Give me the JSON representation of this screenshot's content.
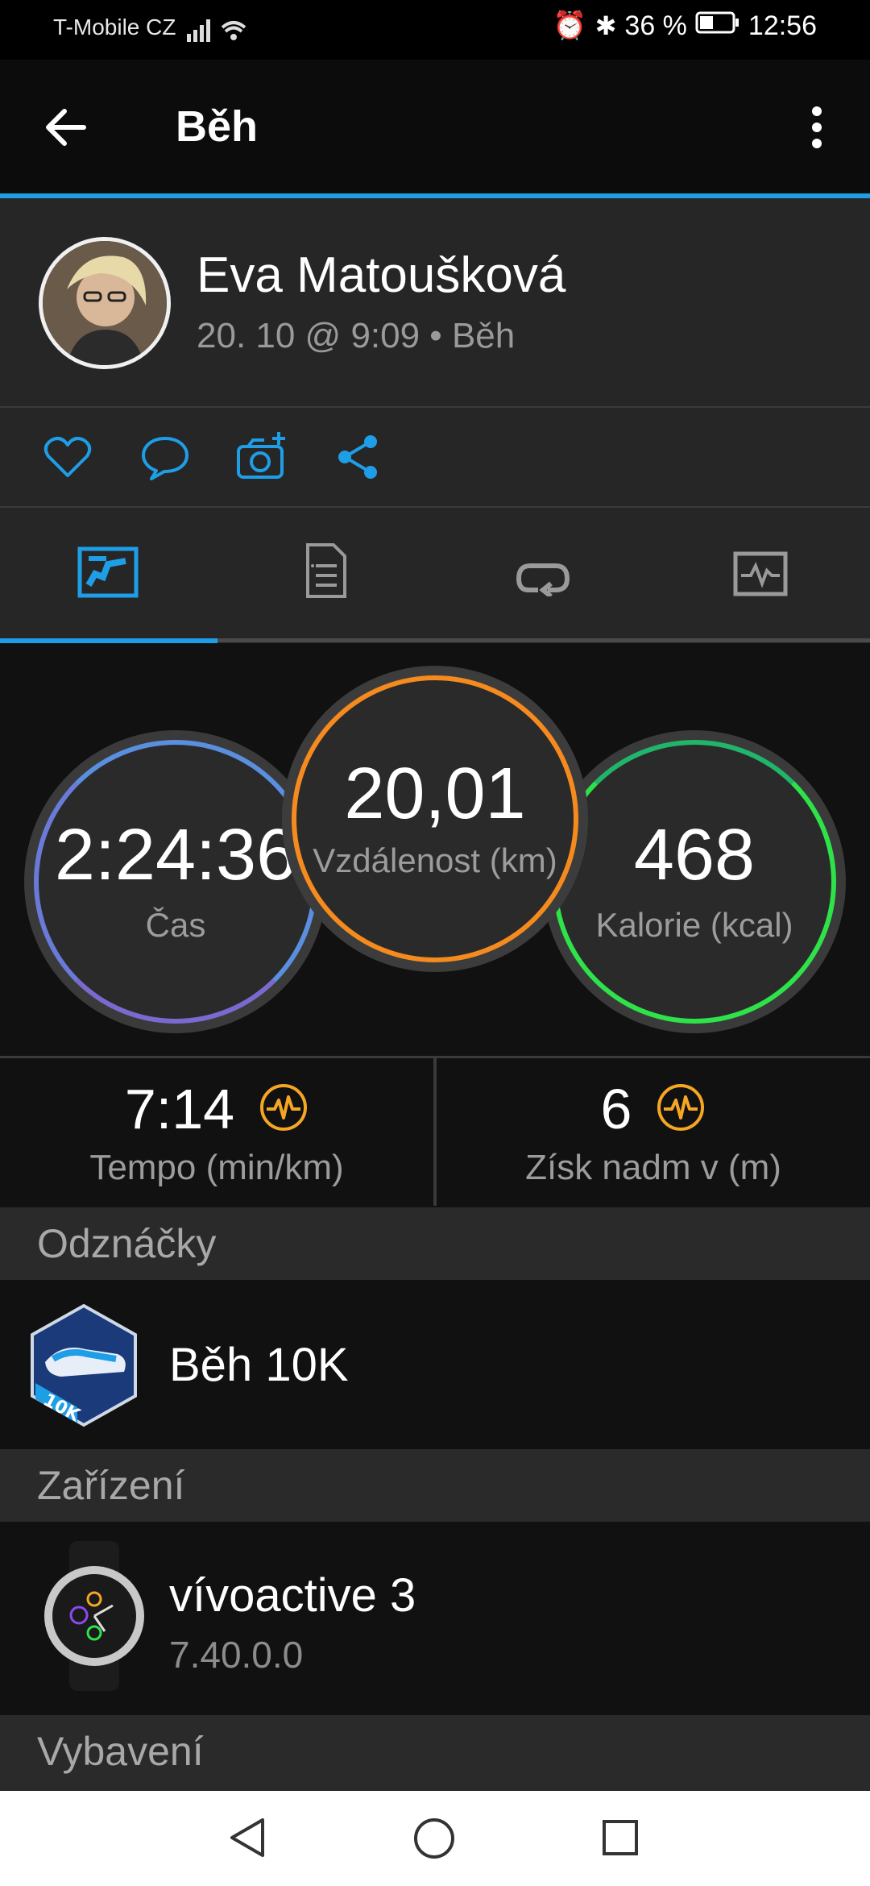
{
  "status_bar": {
    "carrier": "T-Mobile CZ",
    "battery": "36 %",
    "time": "12:56"
  },
  "app_bar": {
    "title": "Běh",
    "back_icon": "arrow-left-icon",
    "menu_icon": "more-vertical-icon"
  },
  "profile": {
    "name": "Eva Matoušková",
    "subtitle": "20. 10 @ 9:09 • Běh"
  },
  "stats": {
    "time": {
      "value": "2:24:36",
      "label": "Čas"
    },
    "distance": {
      "value": "20,01",
      "label": "Vzdálenost (km)"
    },
    "calories": {
      "value": "468",
      "label": "Kalorie (kcal)"
    }
  },
  "pace": {
    "value": "7:14",
    "label": "Tempo (min/km)"
  },
  "elevation": {
    "value": "6",
    "label": "Získ nadm v (m)"
  },
  "sections": {
    "badges": "Odznáčky",
    "device": "Zařízení",
    "gear": "Vybavení"
  },
  "badge": {
    "title": "Běh 10K",
    "badge_text": "10K"
  },
  "device": {
    "name": "vívoactive 3",
    "version": "7.40.0.0"
  },
  "colors": {
    "accent": "#1e9ee6",
    "time_ring": "#5a8fe0",
    "distance_ring": "#f58a1f",
    "calories_ring": "#2ee24a",
    "hr_icon": "#f5a623"
  }
}
